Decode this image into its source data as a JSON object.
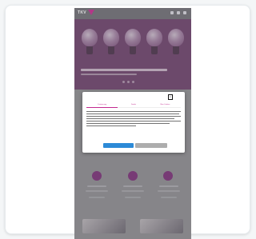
{
  "app": {
    "brand": "TKV"
  },
  "consent": {
    "tabs": [
      {
        "label": "Zustimmung"
      },
      {
        "label": "Details"
      },
      {
        "label": "Über Cookies"
      }
    ],
    "body_text": "",
    "link_text": "",
    "primary_button": "",
    "secondary_button": ""
  },
  "colors": {
    "brand": "#c62a8f",
    "primary_button": "#2c8ad7",
    "overlay": "#8e8d90"
  }
}
